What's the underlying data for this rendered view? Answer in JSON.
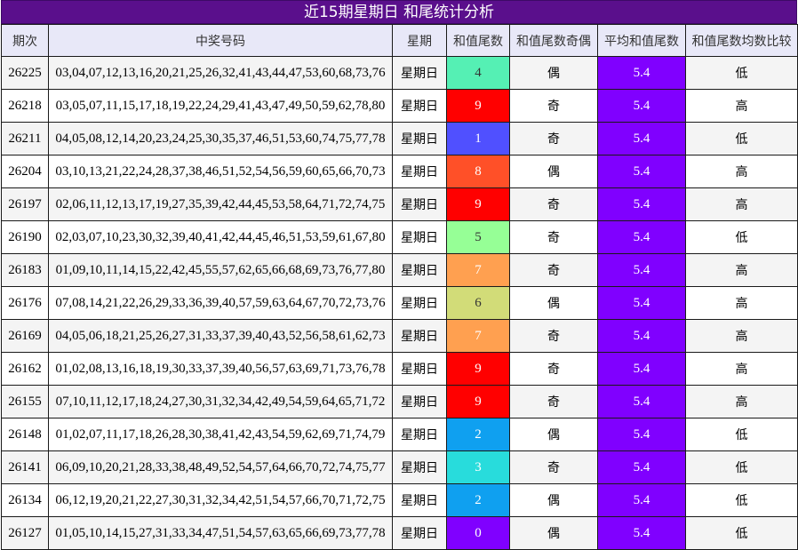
{
  "title": "近15期星期日 和尾统计分析",
  "headers": [
    "期次",
    "中奖号码",
    "星期",
    "和值尾数",
    "和值尾数奇偶",
    "平均和值尾数",
    "和值尾数均数比较"
  ],
  "colors": {
    "title_bg": "#5a0f8c",
    "avg_bg": "#8000ff",
    "header_bg": "#e8e8f8"
  },
  "rows": [
    {
      "period": "26225",
      "numbers": "03,04,07,12,13,16,20,21,25,26,32,41,43,44,47,53,60,68,73,76",
      "weekday": "星期日",
      "tail": "4",
      "tail_color": "#55f0b4",
      "parity": "偶",
      "avg": "5.4",
      "compare": "低"
    },
    {
      "period": "26218",
      "numbers": "03,05,07,11,15,17,18,19,22,24,29,41,43,47,49,50,59,62,78,80",
      "weekday": "星期日",
      "tail": "9",
      "tail_color": "#ff0000",
      "parity": "奇",
      "avg": "5.4",
      "compare": "高"
    },
    {
      "period": "26211",
      "numbers": "04,05,08,12,14,20,23,24,25,30,35,37,46,51,53,60,74,75,77,78",
      "weekday": "星期日",
      "tail": "1",
      "tail_color": "#5050ff",
      "parity": "奇",
      "avg": "5.4",
      "compare": "低"
    },
    {
      "period": "26204",
      "numbers": "03,10,13,21,22,24,28,37,38,46,51,52,54,56,59,60,65,66,70,73",
      "weekday": "星期日",
      "tail": "8",
      "tail_color": "#ff5028",
      "parity": "偶",
      "avg": "5.4",
      "compare": "高"
    },
    {
      "period": "26197",
      "numbers": "02,06,11,12,13,17,19,27,35,39,42,44,45,53,58,64,71,72,74,75",
      "weekday": "星期日",
      "tail": "9",
      "tail_color": "#ff0000",
      "parity": "奇",
      "avg": "5.4",
      "compare": "高"
    },
    {
      "period": "26190",
      "numbers": "02,03,07,10,23,30,32,39,40,41,42,44,45,46,51,53,59,61,67,80",
      "weekday": "星期日",
      "tail": "5",
      "tail_color": "#96ff96",
      "parity": "奇",
      "avg": "5.4",
      "compare": "低"
    },
    {
      "period": "26183",
      "numbers": "01,09,10,11,14,15,22,42,45,55,57,62,65,66,68,69,73,76,77,80",
      "weekday": "星期日",
      "tail": "7",
      "tail_color": "#ffa050",
      "parity": "奇",
      "avg": "5.4",
      "compare": "高"
    },
    {
      "period": "26176",
      "numbers": "07,08,14,21,22,26,29,33,36,39,40,57,59,63,64,67,70,72,73,76",
      "weekday": "星期日",
      "tail": "6",
      "tail_color": "#d2dc78",
      "parity": "偶",
      "avg": "5.4",
      "compare": "高"
    },
    {
      "period": "26169",
      "numbers": "04,05,06,18,21,25,26,27,31,33,37,39,40,43,52,56,58,61,62,73",
      "weekday": "星期日",
      "tail": "7",
      "tail_color": "#ffa050",
      "parity": "奇",
      "avg": "5.4",
      "compare": "高"
    },
    {
      "period": "26162",
      "numbers": "01,02,08,13,16,18,19,30,33,37,39,40,56,57,63,69,71,73,76,78",
      "weekday": "星期日",
      "tail": "9",
      "tail_color": "#ff0000",
      "parity": "奇",
      "avg": "5.4",
      "compare": "高"
    },
    {
      "period": "26155",
      "numbers": "07,10,11,12,17,18,24,27,30,31,32,34,42,49,54,59,64,65,71,72",
      "weekday": "星期日",
      "tail": "9",
      "tail_color": "#ff0000",
      "parity": "奇",
      "avg": "5.4",
      "compare": "高"
    },
    {
      "period": "26148",
      "numbers": "01,02,07,11,17,18,26,28,30,38,41,42,43,54,59,62,69,71,74,79",
      "weekday": "星期日",
      "tail": "2",
      "tail_color": "#0fa0f0",
      "parity": "偶",
      "avg": "5.4",
      "compare": "低"
    },
    {
      "period": "26141",
      "numbers": "06,09,10,20,21,28,33,38,48,49,52,54,57,64,66,70,72,74,75,77",
      "weekday": "星期日",
      "tail": "3",
      "tail_color": "#28dcdc",
      "parity": "奇",
      "avg": "5.4",
      "compare": "低"
    },
    {
      "period": "26134",
      "numbers": "06,12,19,20,21,22,27,30,31,32,34,42,51,54,57,66,70,71,72,75",
      "weekday": "星期日",
      "tail": "2",
      "tail_color": "#0fa0f0",
      "parity": "偶",
      "avg": "5.4",
      "compare": "低"
    },
    {
      "period": "26127",
      "numbers": "01,05,10,14,15,27,31,33,34,47,51,54,57,63,65,66,69,73,77,78",
      "weekday": "星期日",
      "tail": "0",
      "tail_color": "#8000ff",
      "parity": "偶",
      "avg": "5.4",
      "compare": "低"
    }
  ]
}
